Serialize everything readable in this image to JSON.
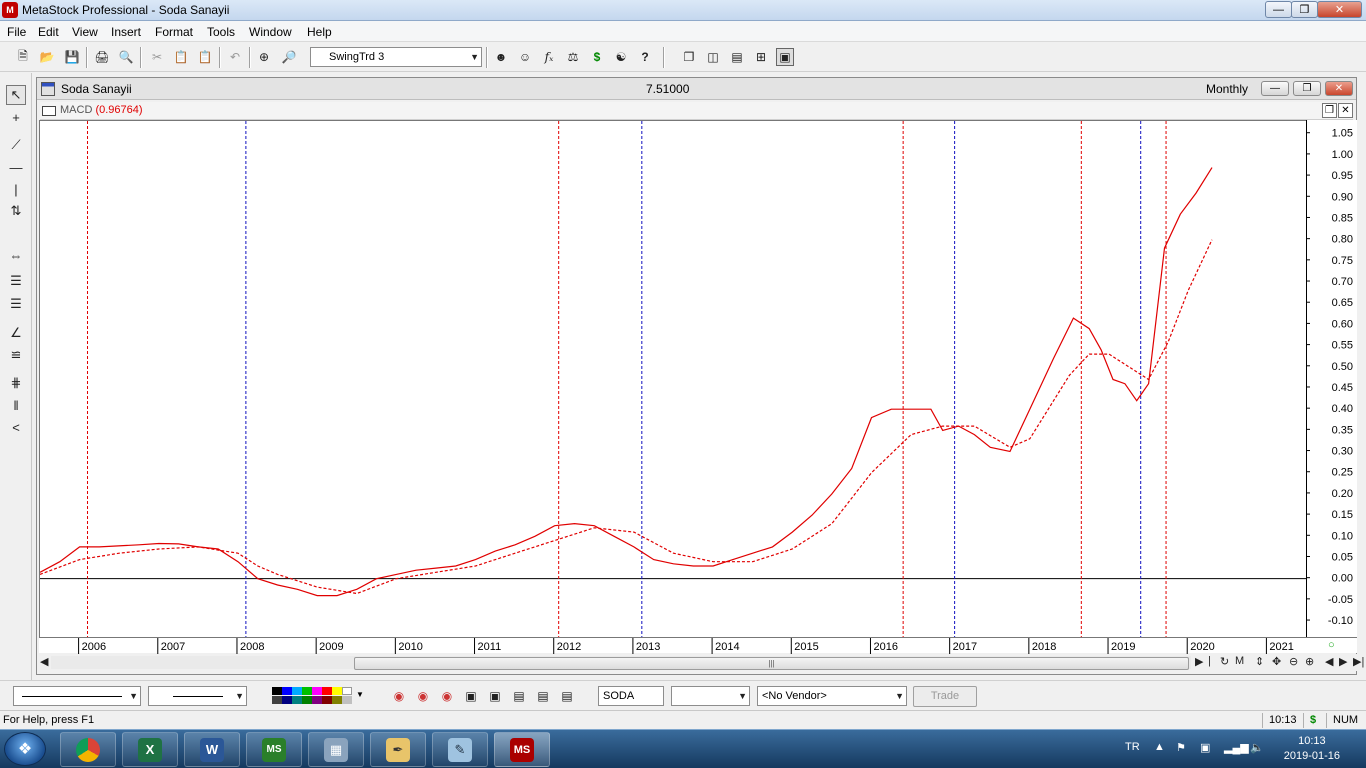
{
  "window": {
    "title": "MetaStock Professional - Soda Sanayii"
  },
  "menu": [
    "File",
    "Edit",
    "View",
    "Insert",
    "Format",
    "Tools",
    "Window",
    "Help"
  ],
  "toolbar": {
    "template_combo": "SwingTrd 3"
  },
  "chart_window": {
    "title": "Soda Sanayii",
    "price": "7.51000",
    "period": "Monthly"
  },
  "indicator": {
    "name": "MACD",
    "value": "(0.96764)"
  },
  "colors": {
    "macd": "#e00000",
    "signal": "#e00000",
    "red_marker": "#e00000",
    "blue_marker": "#1010c0",
    "zero_line": "#000000"
  },
  "chart_data": {
    "type": "line",
    "series": [
      {
        "name": "MACD",
        "style": "solid",
        "points": [
          [
            2005.5,
            0.015
          ],
          [
            2005.75,
            0.04
          ],
          [
            2006.0,
            0.075
          ],
          [
            2006.25,
            0.075
          ],
          [
            2006.75,
            0.08
          ],
          [
            2007.0,
            0.083
          ],
          [
            2007.25,
            0.082
          ],
          [
            2007.5,
            0.075
          ],
          [
            2007.75,
            0.07
          ],
          [
            2008.0,
            0.04
          ],
          [
            2008.25,
            0.0
          ],
          [
            2008.5,
            -0.015
          ],
          [
            2008.75,
            -0.025
          ],
          [
            2009.0,
            -0.04
          ],
          [
            2009.25,
            -0.04
          ],
          [
            2009.5,
            -0.025
          ],
          [
            2009.75,
            0.0
          ],
          [
            2010.0,
            0.01
          ],
          [
            2010.25,
            0.02
          ],
          [
            2010.5,
            0.025
          ],
          [
            2010.75,
            0.03
          ],
          [
            2011.0,
            0.045
          ],
          [
            2011.25,
            0.065
          ],
          [
            2011.5,
            0.08
          ],
          [
            2011.75,
            0.1
          ],
          [
            2012.0,
            0.125
          ],
          [
            2012.25,
            0.13
          ],
          [
            2012.5,
            0.125
          ],
          [
            2012.75,
            0.1
          ],
          [
            2013.0,
            0.075
          ],
          [
            2013.25,
            0.045
          ],
          [
            2013.5,
            0.035
          ],
          [
            2013.75,
            0.03
          ],
          [
            2014.0,
            0.03
          ],
          [
            2014.25,
            0.045
          ],
          [
            2014.5,
            0.06
          ],
          [
            2014.75,
            0.075
          ],
          [
            2015.0,
            0.11
          ],
          [
            2015.25,
            0.15
          ],
          [
            2015.5,
            0.2
          ],
          [
            2015.75,
            0.26
          ],
          [
            2016.0,
            0.38
          ],
          [
            2016.25,
            0.4
          ],
          [
            2016.75,
            0.4
          ],
          [
            2016.9,
            0.35
          ],
          [
            2017.1,
            0.36
          ],
          [
            2017.3,
            0.34
          ],
          [
            2017.5,
            0.31
          ],
          [
            2017.75,
            0.3
          ],
          [
            2018.0,
            0.4
          ],
          [
            2018.3,
            0.52
          ],
          [
            2018.55,
            0.615
          ],
          [
            2018.75,
            0.59
          ],
          [
            2018.9,
            0.54
          ],
          [
            2019.05,
            0.47
          ],
          [
            2019.2,
            0.46
          ],
          [
            2019.35,
            0.42
          ],
          [
            2019.5,
            0.46
          ],
          [
            2019.7,
            0.78
          ],
          [
            2019.9,
            0.86
          ],
          [
            2020.1,
            0.91
          ],
          [
            2020.3,
            0.97
          ]
        ]
      },
      {
        "name": "Signal",
        "style": "dashed",
        "points": [
          [
            2005.5,
            0.01
          ],
          [
            2006.0,
            0.045
          ],
          [
            2006.5,
            0.06
          ],
          [
            2007.0,
            0.07
          ],
          [
            2007.5,
            0.075
          ],
          [
            2008.0,
            0.06
          ],
          [
            2008.25,
            0.03
          ],
          [
            2008.5,
            0.01
          ],
          [
            2009.0,
            -0.02
          ],
          [
            2009.5,
            -0.035
          ],
          [
            2010.0,
            0.0
          ],
          [
            2010.5,
            0.015
          ],
          [
            2011.0,
            0.03
          ],
          [
            2011.5,
            0.06
          ],
          [
            2012.0,
            0.09
          ],
          [
            2012.5,
            0.12
          ],
          [
            2013.0,
            0.11
          ],
          [
            2013.5,
            0.06
          ],
          [
            2014.0,
            0.04
          ],
          [
            2014.5,
            0.04
          ],
          [
            2015.0,
            0.07
          ],
          [
            2015.5,
            0.13
          ],
          [
            2016.0,
            0.25
          ],
          [
            2016.5,
            0.34
          ],
          [
            2016.9,
            0.36
          ],
          [
            2017.3,
            0.36
          ],
          [
            2017.75,
            0.31
          ],
          [
            2018.0,
            0.33
          ],
          [
            2018.5,
            0.48
          ],
          [
            2018.75,
            0.53
          ],
          [
            2019.0,
            0.53
          ],
          [
            2019.5,
            0.47
          ],
          [
            2019.75,
            0.56
          ],
          [
            2020.0,
            0.68
          ],
          [
            2020.3,
            0.8
          ]
        ]
      }
    ],
    "markers": [
      {
        "x": 2006.1,
        "color": "red"
      },
      {
        "x": 2008.1,
        "color": "blue"
      },
      {
        "x": 2012.05,
        "color": "red"
      },
      {
        "x": 2013.1,
        "color": "blue"
      },
      {
        "x": 2016.4,
        "color": "red"
      },
      {
        "x": 2017.05,
        "color": "blue"
      },
      {
        "x": 2018.65,
        "color": "red"
      },
      {
        "x": 2019.4,
        "color": "blue"
      },
      {
        "x": 2019.72,
        "color": "red"
      }
    ],
    "xlim": [
      2005.5,
      2021.5
    ],
    "ylim": [
      -0.14,
      1.08
    ],
    "x_ticks": [
      "2006",
      "2007",
      "2008",
      "2009",
      "2010",
      "2011",
      "2012",
      "2013",
      "2014",
      "2015",
      "2016",
      "2017",
      "2018",
      "2019",
      "2020",
      "2021"
    ],
    "y_ticks": [
      "1.05",
      "1.00",
      "0.95",
      "0.90",
      "0.85",
      "0.80",
      "0.75",
      "0.70",
      "0.65",
      "0.60",
      "0.55",
      "0.50",
      "0.45",
      "0.40",
      "0.35",
      "0.30",
      "0.25",
      "0.20",
      "0.15",
      "0.10",
      "0.05",
      "0.00",
      "-0.05",
      "-0.10"
    ]
  },
  "bottom_toolbar": {
    "symbol": "SODA",
    "vendor": "<No Vendor>",
    "trade_label": "Trade"
  },
  "status": {
    "help": "For Help, press F1",
    "time": "10:13",
    "num": "NUM"
  },
  "taskbar": {
    "lang": "TR",
    "clock_time": "10:13",
    "clock_date": "2019-01-16"
  }
}
